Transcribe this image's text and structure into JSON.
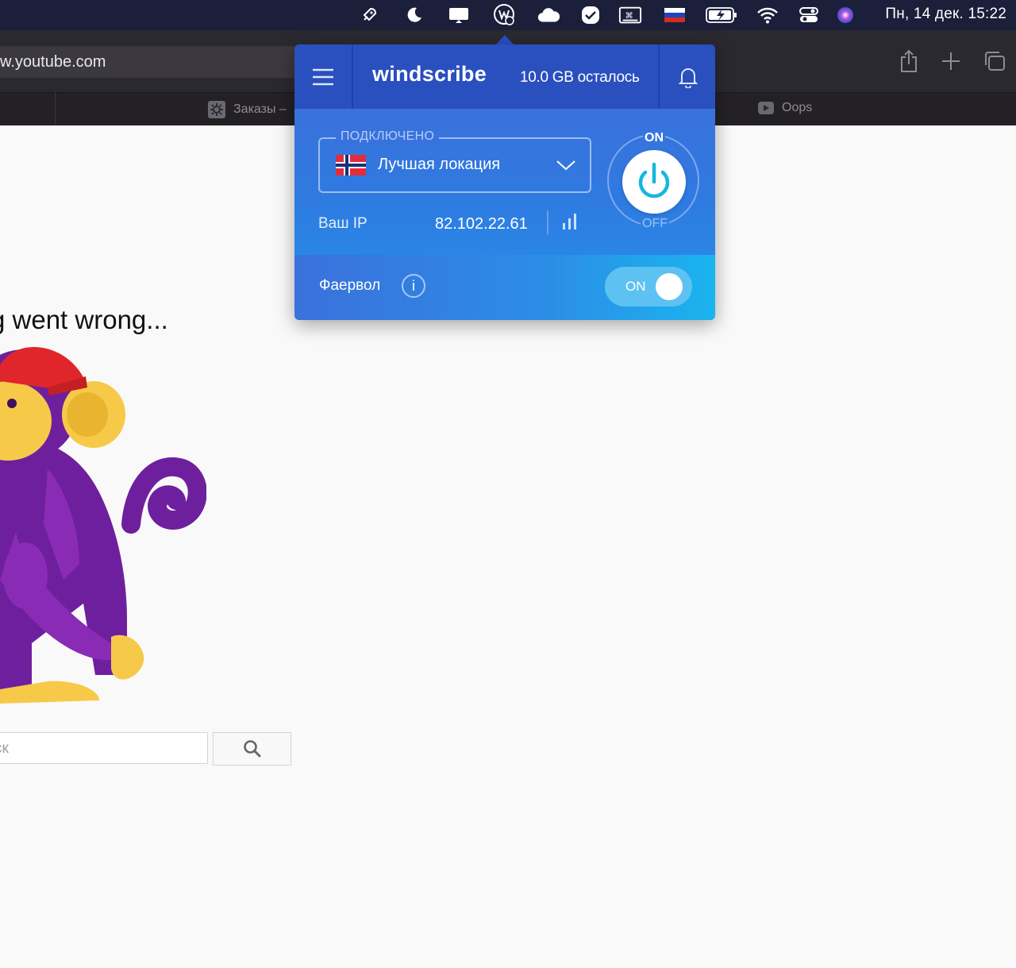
{
  "menubar": {
    "clock": "Пн, 14 дек.  15:22",
    "icons": [
      "rocket-icon",
      "moon-icon",
      "display-icon",
      "windscribe-icon",
      "cloud-icon",
      "check-badge-icon",
      "command-icon",
      "russian-flag-icon",
      "battery-charging-icon",
      "wifi-icon",
      "control-center-icon",
      "siri-icon"
    ]
  },
  "browser": {
    "url": "w.youtube.com",
    "tabs": [
      {
        "label": "Заказы –"
      },
      {
        "label": "Oops"
      }
    ]
  },
  "page": {
    "error_title": "g went wrong...",
    "search_placeholder": "ск"
  },
  "windscribe": {
    "logo": "windscribe",
    "data_left": "10.0 GB осталось",
    "status_label": "ПОДКЛЮЧЕНО",
    "location": "Лучшая локация",
    "ip_label": "Ваш IP",
    "ip": "82.102.22.61",
    "power_on": "ON",
    "power_off": "OFF",
    "firewall_label": "Фаервол",
    "firewall_info": "i",
    "firewall_state": "ON",
    "colors": {
      "header": "#2a4fbf",
      "accent": "#1ab4ef",
      "power": "#16b6e0"
    }
  }
}
